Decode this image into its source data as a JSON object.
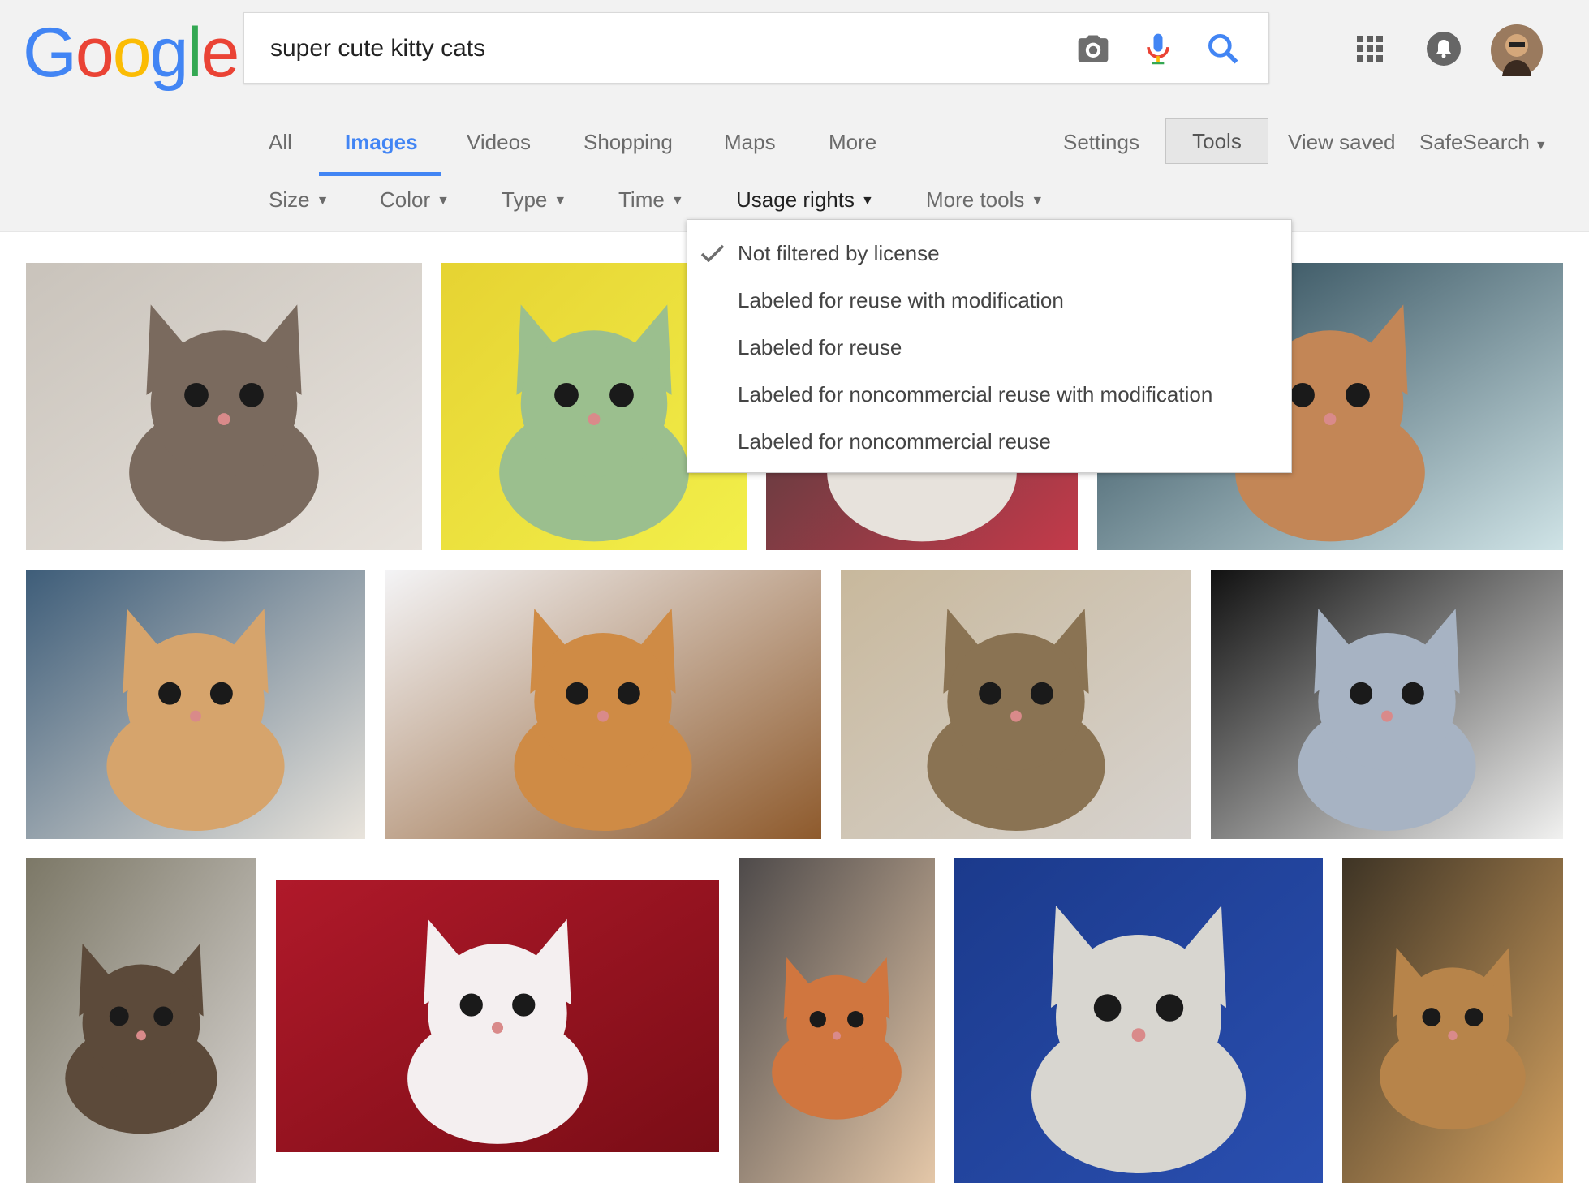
{
  "logo": {
    "letters": [
      "G",
      "o",
      "o",
      "g",
      "l",
      "e"
    ],
    "colors": [
      "#4285f4",
      "#ea4335",
      "#fbbc05",
      "#4285f4",
      "#34a853",
      "#ea4335"
    ]
  },
  "search": {
    "query": "super cute kitty cats"
  },
  "header_icons": [
    "camera-icon",
    "microphone-icon",
    "search-icon",
    "apps-grid-icon",
    "notifications-bell-icon",
    "avatar"
  ],
  "tabs": [
    "All",
    "Images",
    "Videos",
    "Shopping",
    "Maps",
    "More"
  ],
  "right_links": {
    "settings": "Settings",
    "tools": "Tools",
    "view_saved": "View saved",
    "safesearch": "SafeSearch"
  },
  "tools": [
    "Size",
    "Color",
    "Type",
    "Time",
    "Usage rights",
    "More tools"
  ],
  "usage_menu": {
    "selected": "Not filtered by license",
    "items": [
      "Not filtered by license",
      "Labeled for reuse with modification",
      "Labeled for reuse",
      "Labeled for noncommercial reuse with modification",
      "Labeled for noncommercial reuse"
    ]
  },
  "results": [
    {
      "row": 1,
      "description": "grey kitten close-up",
      "colors": [
        "#c9c3bb",
        "#7a6a5e",
        "#e8e3dd"
      ]
    },
    {
      "row": 1,
      "description": "yellow kitten",
      "colors": [
        "#e6d332",
        "#9bbf8e",
        "#f2ef4a"
      ]
    },
    {
      "row": 1,
      "description": "kitten with bow",
      "colors": [
        "#3d3d3d",
        "#e7e2dc",
        "#c43a4a"
      ]
    },
    {
      "row": 1,
      "description": "orange kitten",
      "colors": [
        "#1d3b4a",
        "#c38656",
        "#cfe3e6"
      ]
    },
    {
      "row": 2,
      "description": "kitten in denim",
      "colors": [
        "#3e5d79",
        "#d6a46c",
        "#e9e4dc"
      ]
    },
    {
      "row": 2,
      "description": "kitten on back",
      "colors": [
        "#f4f4f6",
        "#cf8b45",
        "#8e5a2c"
      ]
    },
    {
      "row": 2,
      "description": "silver tabby",
      "colors": [
        "#c8b89c",
        "#8a7353",
        "#d7d3cf"
      ]
    },
    {
      "row": 2,
      "description": "white kitten",
      "colors": [
        "#111111",
        "#a7b3c3",
        "#f1f1f0"
      ]
    },
    {
      "row": 3,
      "description": "kitten with flowers",
      "colors": [
        "#7c7867",
        "#5c4a3a",
        "#d9d5d2"
      ]
    },
    {
      "row": 3,
      "description": "white kitten on red",
      "colors": [
        "#b0192a",
        "#f4eff0",
        "#7a0d16"
      ]
    },
    {
      "row": 3,
      "description": "ginger kitten",
      "colors": [
        "#4e4a4a",
        "#d0763f",
        "#e4c7a8"
      ]
    },
    {
      "row": 3,
      "description": "tabby on blue",
      "colors": [
        "#1b3a8c",
        "#d8d6d0",
        "#2a4fb0"
      ]
    },
    {
      "row": 3,
      "description": "abyssinian cat",
      "colors": [
        "#3e3425",
        "#b7844a",
        "#d2a05f"
      ]
    }
  ]
}
